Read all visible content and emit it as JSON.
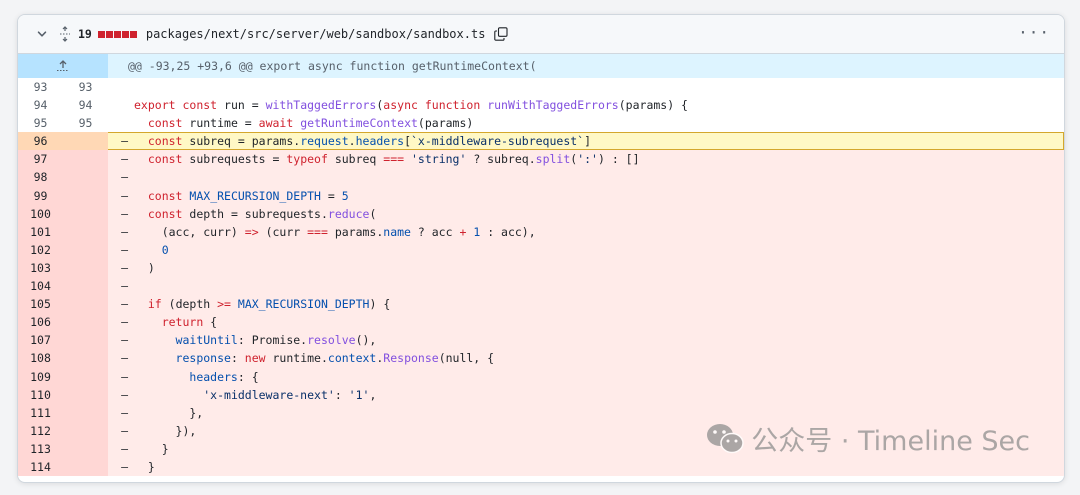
{
  "file": {
    "changes": "19",
    "path": "packages/next/src/server/web/sandbox/sandbox.ts",
    "diffstat_colors": [
      "#cf222e",
      "#cf222e",
      "#cf222e",
      "#cf222e",
      "#cf222e"
    ]
  },
  "icons": {
    "collapse": "chevron-down-icon",
    "expand": "unfold-icon",
    "copy": "copy-icon",
    "menu": "kebab-menu-icon",
    "expand_up": "expand-up-icon",
    "watermark": "wechat-icon"
  },
  "hunk": {
    "header": "@@ -93,25 +93,6 @@ export async function getRuntimeContext("
  },
  "lines": [
    {
      "old": "93",
      "new": "93",
      "marker": "",
      "type": "ctx",
      "tokens": []
    },
    {
      "old": "94",
      "new": "94",
      "marker": "",
      "type": "ctx",
      "tokens": [
        [
          "kw",
          "export"
        ],
        [
          "t",
          " "
        ],
        [
          "kw",
          "const"
        ],
        [
          "t",
          " run = "
        ],
        [
          "fn",
          "withTaggedErrors"
        ],
        [
          "t",
          "("
        ],
        [
          "kw",
          "async"
        ],
        [
          "t",
          " "
        ],
        [
          "kw",
          "function"
        ],
        [
          "t",
          " "
        ],
        [
          "fn",
          "runWithTaggedErrors"
        ],
        [
          "t",
          "(params) {"
        ]
      ]
    },
    {
      "old": "95",
      "new": "95",
      "marker": "",
      "type": "ctx",
      "tokens": [
        [
          "t",
          "  "
        ],
        [
          "kw",
          "const"
        ],
        [
          "t",
          " runtime = "
        ],
        [
          "kw",
          "await"
        ],
        [
          "t",
          " "
        ],
        [
          "fn",
          "getRuntimeContext"
        ],
        [
          "t",
          "(params)"
        ]
      ]
    },
    {
      "old": "96",
      "new": "",
      "marker": "–",
      "type": "hl",
      "tokens": [
        [
          "t",
          "  "
        ],
        [
          "kw",
          "const"
        ],
        [
          "t",
          " subreq = params."
        ],
        [
          "pr",
          "request"
        ],
        [
          "t",
          "."
        ],
        [
          "pr",
          "headers"
        ],
        [
          "t",
          "["
        ],
        [
          "st",
          "`x-middleware-subrequest`"
        ],
        [
          "t",
          "]"
        ]
      ]
    },
    {
      "old": "97",
      "new": "",
      "marker": "–",
      "type": "del",
      "tokens": [
        [
          "t",
          "  "
        ],
        [
          "kw",
          "const"
        ],
        [
          "t",
          " subrequests = "
        ],
        [
          "kw",
          "typeof"
        ],
        [
          "t",
          " subreq "
        ],
        [
          "kw",
          "==="
        ],
        [
          "t",
          " "
        ],
        [
          "st",
          "'string'"
        ],
        [
          "t",
          " ? subreq."
        ],
        [
          "fn",
          "split"
        ],
        [
          "t",
          "("
        ],
        [
          "st",
          "':'"
        ],
        [
          "t",
          ") : []"
        ]
      ]
    },
    {
      "old": "98",
      "new": "",
      "marker": "–",
      "type": "del",
      "tokens": []
    },
    {
      "old": "99",
      "new": "",
      "marker": "–",
      "type": "del",
      "tokens": [
        [
          "t",
          "  "
        ],
        [
          "kw",
          "const"
        ],
        [
          "t",
          " "
        ],
        [
          "cn",
          "MAX_RECURSION_DEPTH"
        ],
        [
          "t",
          " = "
        ],
        [
          "cn",
          "5"
        ]
      ]
    },
    {
      "old": "100",
      "new": "",
      "marker": "–",
      "type": "del",
      "tokens": [
        [
          "t",
          "  "
        ],
        [
          "kw",
          "const"
        ],
        [
          "t",
          " depth = subrequests."
        ],
        [
          "fn",
          "reduce"
        ],
        [
          "t",
          "("
        ]
      ]
    },
    {
      "old": "101",
      "new": "",
      "marker": "–",
      "type": "del",
      "tokens": [
        [
          "t",
          "    (acc, curr) "
        ],
        [
          "kw",
          "=>"
        ],
        [
          "t",
          " (curr "
        ],
        [
          "kw",
          "==="
        ],
        [
          "t",
          " params."
        ],
        [
          "pr",
          "name"
        ],
        [
          "t",
          " ? acc "
        ],
        [
          "kw",
          "+"
        ],
        [
          "t",
          " "
        ],
        [
          "cn",
          "1"
        ],
        [
          "t",
          " : acc),"
        ]
      ]
    },
    {
      "old": "102",
      "new": "",
      "marker": "–",
      "type": "del",
      "tokens": [
        [
          "t",
          "    "
        ],
        [
          "cn",
          "0"
        ]
      ]
    },
    {
      "old": "103",
      "new": "",
      "marker": "–",
      "type": "del",
      "tokens": [
        [
          "t",
          "  )"
        ]
      ]
    },
    {
      "old": "104",
      "new": "",
      "marker": "–",
      "type": "del",
      "tokens": []
    },
    {
      "old": "105",
      "new": "",
      "marker": "–",
      "type": "del",
      "tokens": [
        [
          "t",
          "  "
        ],
        [
          "kw",
          "if"
        ],
        [
          "t",
          " (depth "
        ],
        [
          "kw",
          ">="
        ],
        [
          "t",
          " "
        ],
        [
          "cn",
          "MAX_RECURSION_DEPTH"
        ],
        [
          "t",
          ") {"
        ]
      ]
    },
    {
      "old": "106",
      "new": "",
      "marker": "–",
      "type": "del",
      "tokens": [
        [
          "t",
          "    "
        ],
        [
          "kw",
          "return"
        ],
        [
          "t",
          " {"
        ]
      ]
    },
    {
      "old": "107",
      "new": "",
      "marker": "–",
      "type": "del",
      "tokens": [
        [
          "t",
          "      "
        ],
        [
          "pr",
          "waitUntil"
        ],
        [
          "t",
          ": Promise."
        ],
        [
          "fn",
          "resolve"
        ],
        [
          "t",
          "(),"
        ]
      ]
    },
    {
      "old": "108",
      "new": "",
      "marker": "–",
      "type": "del",
      "tokens": [
        [
          "t",
          "      "
        ],
        [
          "pr",
          "response"
        ],
        [
          "t",
          ": "
        ],
        [
          "kw",
          "new"
        ],
        [
          "t",
          " runtime."
        ],
        [
          "pr",
          "context"
        ],
        [
          "t",
          "."
        ],
        [
          "fn",
          "Response"
        ],
        [
          "t",
          "(null, {"
        ]
      ]
    },
    {
      "old": "109",
      "new": "",
      "marker": "–",
      "type": "del",
      "tokens": [
        [
          "t",
          "        "
        ],
        [
          "pr",
          "headers"
        ],
        [
          "t",
          ": {"
        ]
      ]
    },
    {
      "old": "110",
      "new": "",
      "marker": "–",
      "type": "del",
      "tokens": [
        [
          "t",
          "          "
        ],
        [
          "st",
          "'x-middleware-next'"
        ],
        [
          "t",
          ": "
        ],
        [
          "st",
          "'1'"
        ],
        [
          "t",
          ","
        ]
      ]
    },
    {
      "old": "111",
      "new": "",
      "marker": "–",
      "type": "del",
      "tokens": [
        [
          "t",
          "        },"
        ]
      ]
    },
    {
      "old": "112",
      "new": "",
      "marker": "–",
      "type": "del",
      "tokens": [
        [
          "t",
          "      }),"
        ]
      ]
    },
    {
      "old": "113",
      "new": "",
      "marker": "–",
      "type": "del",
      "tokens": [
        [
          "t",
          "    }"
        ]
      ]
    },
    {
      "old": "114",
      "new": "",
      "marker": "–",
      "type": "del",
      "tokens": [
        [
          "t",
          "  }"
        ]
      ]
    }
  ],
  "watermark": {
    "text": "公众号 · Timeline Sec"
  }
}
